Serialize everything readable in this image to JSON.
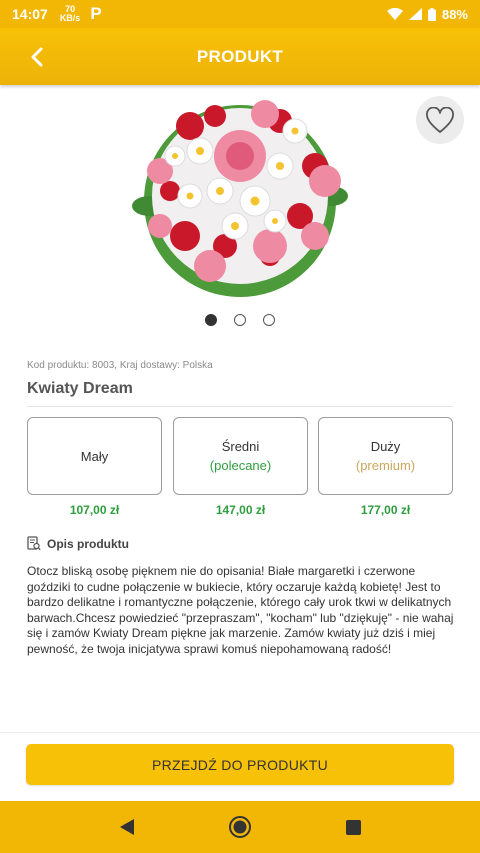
{
  "status_bar": {
    "time": "14:07",
    "speed_value": "70",
    "speed_unit": "KB/s",
    "app_icon": "P",
    "battery": "88%",
    "icons": [
      "wifi-icon",
      "signal-icon",
      "battery-icon"
    ]
  },
  "header": {
    "title": "PRODUKT",
    "back_icon": "chevron-left-icon"
  },
  "product": {
    "favorite_icon": "heart-outline-icon",
    "image_alt": "bouquet",
    "carousel_dots": 3,
    "carousel_active": 0,
    "meta": "Kod produktu: 8003, Kraj dostawy: Polska",
    "name": "Kwiaty Dream"
  },
  "sizes": [
    {
      "label": "Mały",
      "sub": "",
      "price": "107,00 zł"
    },
    {
      "label": "Średni",
      "sub": "(polecane)",
      "price": "147,00 zł"
    },
    {
      "label": "Duży",
      "sub": "(premium)",
      "price": "177,00 zł"
    }
  ],
  "description": {
    "heading": "Opis produktu",
    "text": "Otocz bliską osobę pięknem nie do opisania! Białe margaretki i czerwone goździki to cudne połączenie w bukiecie, który oczaruje każdą kobietę! Jest to bardzo delikatne i romantyczne połączenie, którego cały urok tkwi w delikatnych barwach.Chcesz powiedzieć \"przepraszam\", \"kocham\" lub \"dziękuję\" - nie wahaj się i zamów Kwiaty Dream piękne jak marzenie. Zamów kwiaty już dziś i miej pewność, że twoja inicjatywa sprawi komuś niepohamowaną radość!"
  },
  "cta": {
    "label": "PRZEJDŹ DO PRODUKTU"
  },
  "nav": {
    "icons": [
      "back-triangle-icon",
      "home-circle-icon",
      "recents-square-icon"
    ]
  },
  "colors": {
    "brand_yellow": "#f2b705",
    "price_green": "#2e9e3e",
    "premium_gold": "#c9a65a"
  }
}
